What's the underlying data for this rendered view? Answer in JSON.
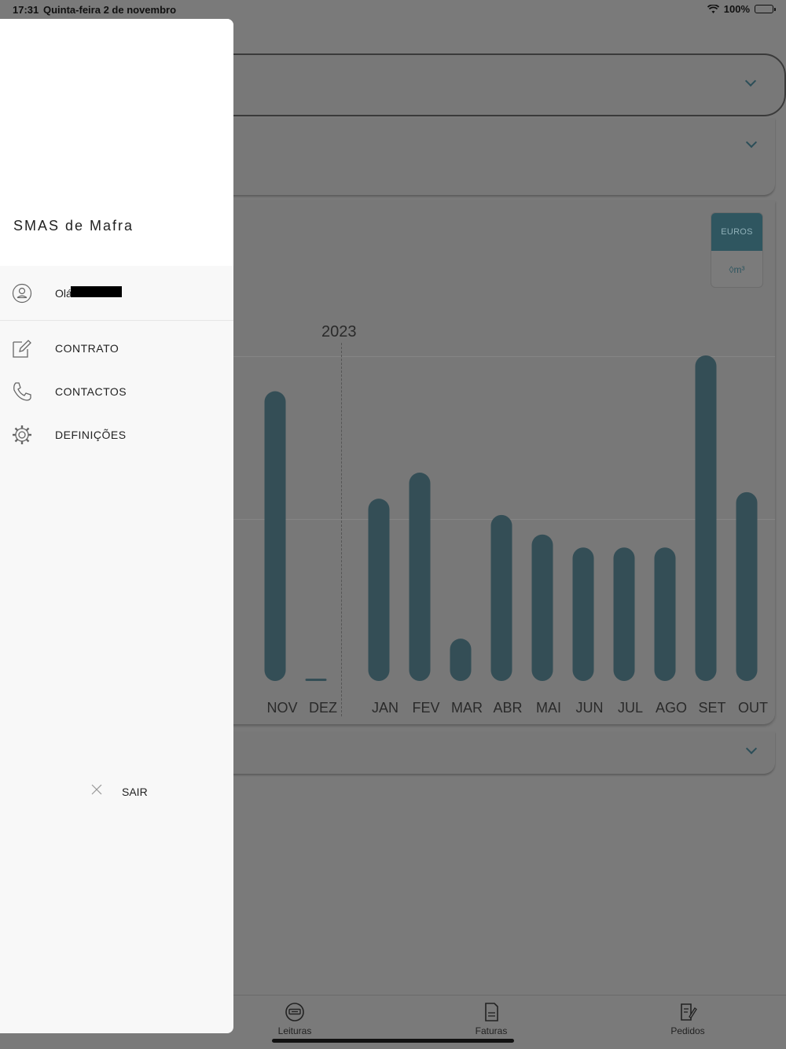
{
  "status_bar": {
    "time": "17:31",
    "date": "Quinta-feira 2 de novembro",
    "battery": "100%"
  },
  "drawer": {
    "brand": "SMAS de Mafra",
    "greeting": "Olá",
    "menu": [
      {
        "label": "CONTRATO",
        "icon": "edit-icon"
      },
      {
        "label": "CONTACTOS",
        "icon": "phone-icon"
      },
      {
        "label": "DEFINIÇÕES",
        "icon": "gear-icon"
      }
    ],
    "logout_label": "SAIR"
  },
  "unit_toggle": {
    "euros_label": "EUROS",
    "m3_label": "m³",
    "selected": "EUROS"
  },
  "chart_data": {
    "type": "bar",
    "categories": [
      "NOV",
      "DEZ",
      "JAN",
      "FEV",
      "MAR",
      "ABR",
      "MAI",
      "JUN",
      "JUL",
      "AGO",
      "SET",
      "OUT"
    ],
    "values": [
      0.89,
      0.0,
      0.56,
      0.64,
      0.13,
      0.51,
      0.45,
      0.41,
      0.41,
      0.41,
      1.0,
      0.58
    ],
    "year_marker": "2023",
    "bar_color": "#344e56"
  },
  "tab_bar": {
    "tabs": [
      {
        "label": "Leituras",
        "icon": "readings-icon"
      },
      {
        "label": "Faturas",
        "icon": "invoice-icon"
      },
      {
        "label": "Pedidos",
        "icon": "requests-icon"
      }
    ]
  }
}
